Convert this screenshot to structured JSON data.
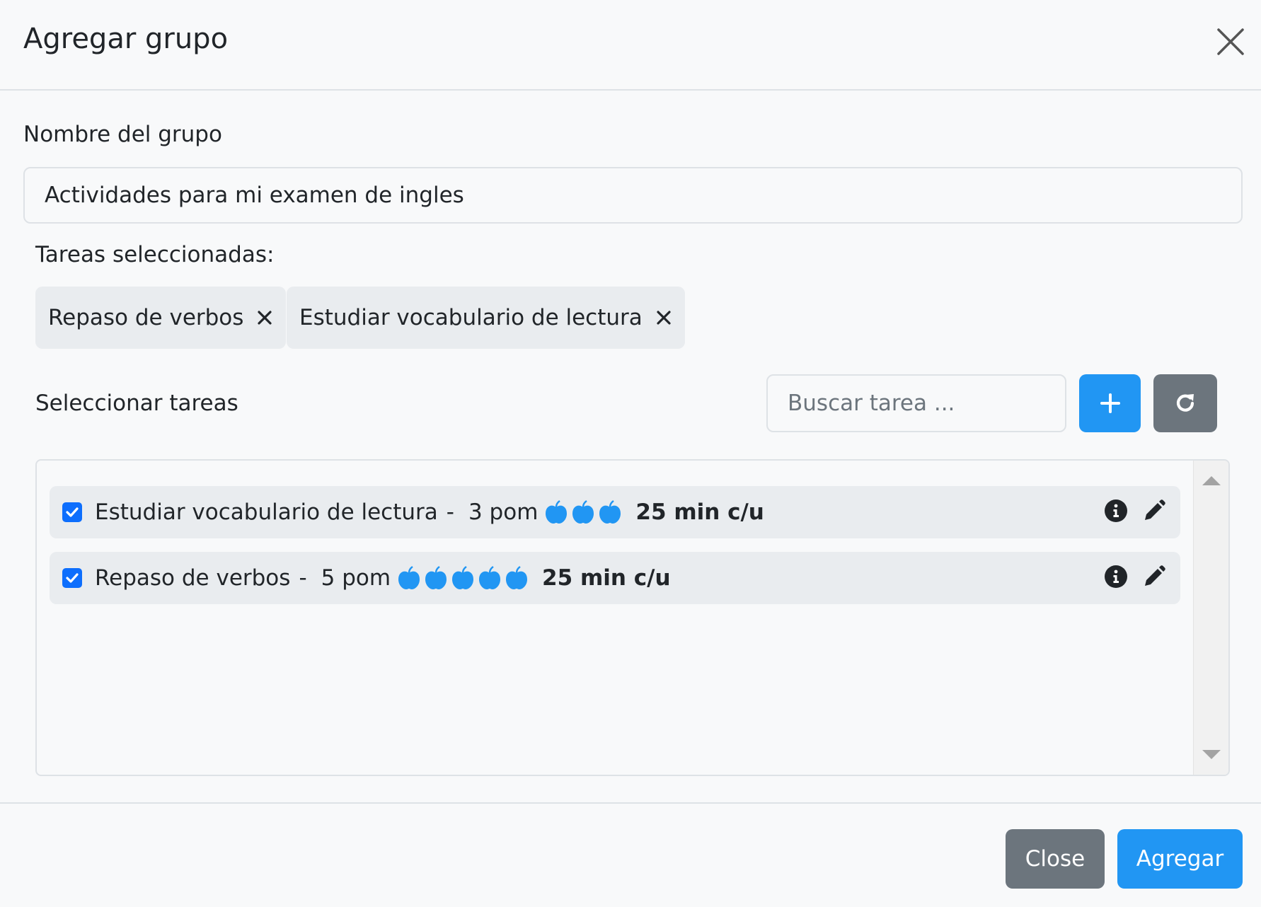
{
  "header": {
    "title": "Agregar grupo",
    "close_icon": "close-icon"
  },
  "form": {
    "group_name_label": "Nombre del grupo",
    "group_name_value": "Actividades para mi examen de ingles",
    "selected_label": "Tareas seleccionadas:",
    "selected_chips": [
      {
        "label": "Repaso de verbos"
      },
      {
        "label": "Estudiar vocabulario de lectura"
      }
    ],
    "select_label": "Seleccionar tareas",
    "search_placeholder": "Buscar tarea ..."
  },
  "tasks": [
    {
      "name": "Estudiar vocabulario de lectura",
      "separator": "-",
      "pom": "3 pom",
      "pom_count": 3,
      "duration": "25 min c/u",
      "checked": true
    },
    {
      "name": "Repaso de verbos",
      "separator": "-",
      "pom": "5 pom",
      "pom_count": 5,
      "duration": "25 min c/u",
      "checked": true
    }
  ],
  "footer": {
    "close_label": "Close",
    "add_label": "Agregar"
  },
  "colors": {
    "primary": "#2196f3",
    "secondary": "#6c757d",
    "checkbox": "#0d6efd",
    "row_bg": "#e9ecef",
    "page_bg": "#f8f9fa"
  }
}
